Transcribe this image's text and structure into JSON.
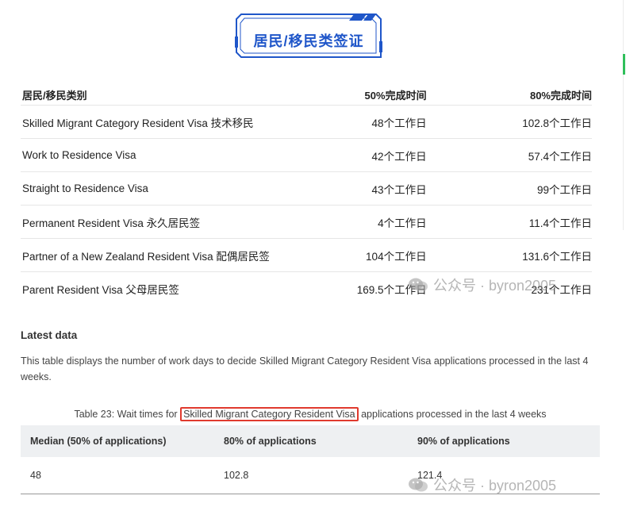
{
  "banner": {
    "title": "居民/移民类签证"
  },
  "resident_table": {
    "headers": [
      "居民/移民类别",
      "50%完成时间",
      "80%完成时间"
    ],
    "rows": [
      {
        "category": "Skilled Migrant Category Resident Visa 技术移民",
        "p50": "48个工作日",
        "p80": "102.8个工作日"
      },
      {
        "category": "Work to Residence Visa",
        "p50": "42个工作日",
        "p80": "57.4个工作日"
      },
      {
        "category": "Straight to Residence Visa",
        "p50": "43个工作日",
        "p80": "99个工作日"
      },
      {
        "category": "Permanent Resident Visa 永久居民签",
        "p50": "4个工作日",
        "p80": "11.4个工作日"
      },
      {
        "category": "Partner of a New Zealand Resident Visa 配偶居民签",
        "p50": "104个工作日",
        "p80": "131.6个工作日"
      },
      {
        "category": "Parent Resident Visa 父母居民签",
        "p50": "169.5个工作日",
        "p80": "231个工作日"
      }
    ]
  },
  "latest": {
    "title": "Latest data",
    "description": "This table displays the number of work days to decide Skilled Migrant Category Resident Visa applications processed in the last 4 weeks.",
    "caption_before": "Table 23: Wait times for ",
    "caption_highlight": "Skilled Migrant Category Resident Visa",
    "caption_after": " applications processed in the last 4 weeks"
  },
  "wait_table": {
    "headers": [
      "Median (50% of applications)",
      "80% of applications",
      "90% of applications"
    ],
    "row": [
      "48",
      "102.8",
      "121.4"
    ]
  },
  "watermark": {
    "text": "公众号 · byron2005"
  },
  "colors": {
    "banner_blue": "#1f56c9",
    "highlight_red": "#e03a2e"
  }
}
